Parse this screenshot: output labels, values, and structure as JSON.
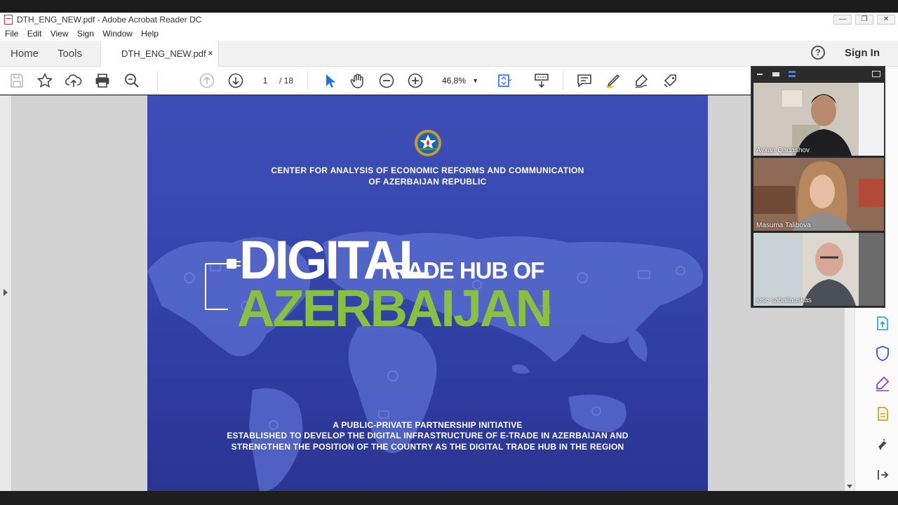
{
  "window": {
    "title": "DTH_ENG_NEW.pdf - Adobe Acrobat Reader DC",
    "controls": [
      "minimize",
      "restore",
      "close"
    ]
  },
  "menu": [
    "File",
    "Edit",
    "View",
    "Sign",
    "Window",
    "Help"
  ],
  "tabs": {
    "home": "Home",
    "tools": "Tools",
    "document": "DTH_ENG_NEW.pdf",
    "close_glyph": "×",
    "help_glyph": "?",
    "sign_in": "Sign In"
  },
  "toolbar": {
    "page_current": "1",
    "page_total": "/ 18",
    "zoom": "46,8%",
    "icons": [
      "save-icon",
      "star-icon",
      "upload-icon",
      "print-icon",
      "search-icon",
      "prev-page-icon",
      "next-page-icon",
      "select-cursor-icon",
      "hand-icon",
      "zoom-out-icon",
      "zoom-in-icon",
      "fit-page-icon",
      "scroll-mode-icon",
      "comment-icon",
      "highlight-icon",
      "sign-icon",
      "more-tools-icon"
    ]
  },
  "document": {
    "org_line1": "CENTER FOR ANALYSIS OF ECONOMIC REFORMS AND COMMUNICATION",
    "org_line2": "OF AZERBAIJAN REPUBLIC",
    "title_big": "DIGITAL",
    "title_small": "TRADE HUB OF",
    "title_country": "AZERBAIJAN",
    "footer_line1": "A PUBLIC-PRIVATE PARTNERSHIP INITIATIVE",
    "footer_line2": "ESTABLISHED TO DEVELOP THE DIGITAL INFRASTRUCTURE OF E-TRADE IN AZERBAIJAN AND",
    "footer_line3": "STRENGTHEN THE POSITION OF THE COUNTRY AS THE DIGITAL TRADE HUB IN THE REGION",
    "colors": {
      "background": "#3747b0",
      "accent_green": "#8bbf3f"
    }
  },
  "video_call": {
    "participants": [
      {
        "name": "Ayxan Qadashov"
      },
      {
        "name": "Masuma Talibova"
      },
      {
        "name": "jose sabaliauskas"
      }
    ]
  },
  "right_panel_icons": [
    "export-pdf-icon",
    "protect-icon",
    "fill-sign-icon",
    "organize-icon",
    "tools-more-icon",
    "collapse-panel-icon"
  ]
}
